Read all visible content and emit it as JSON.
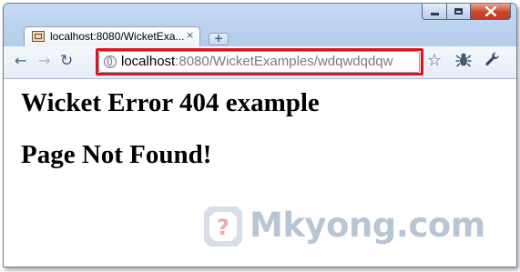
{
  "browser": {
    "tab": {
      "title": "localhost:8080/WicketExa...",
      "close": "×",
      "favicon": "page-icon"
    },
    "new_tab": "+",
    "nav": {
      "back": "←",
      "forward": "→",
      "reload": "↻"
    },
    "address": {
      "host": "localhost",
      "rest": ":8080/WicketExamples/wdqwdqdqw",
      "icon": "globe-icon"
    },
    "toolbar_icons": {
      "star": "☆",
      "bug": "✺",
      "wrench": "🔧"
    }
  },
  "page": {
    "title": "Wicket Error 404 example",
    "subtitle": "Page Not Found!"
  },
  "watermark": {
    "text": "Mkyong.com"
  },
  "colors": {
    "highlight": "#e0141c",
    "titlebar": "#bcd3ee",
    "close_button": "#c9452b"
  }
}
